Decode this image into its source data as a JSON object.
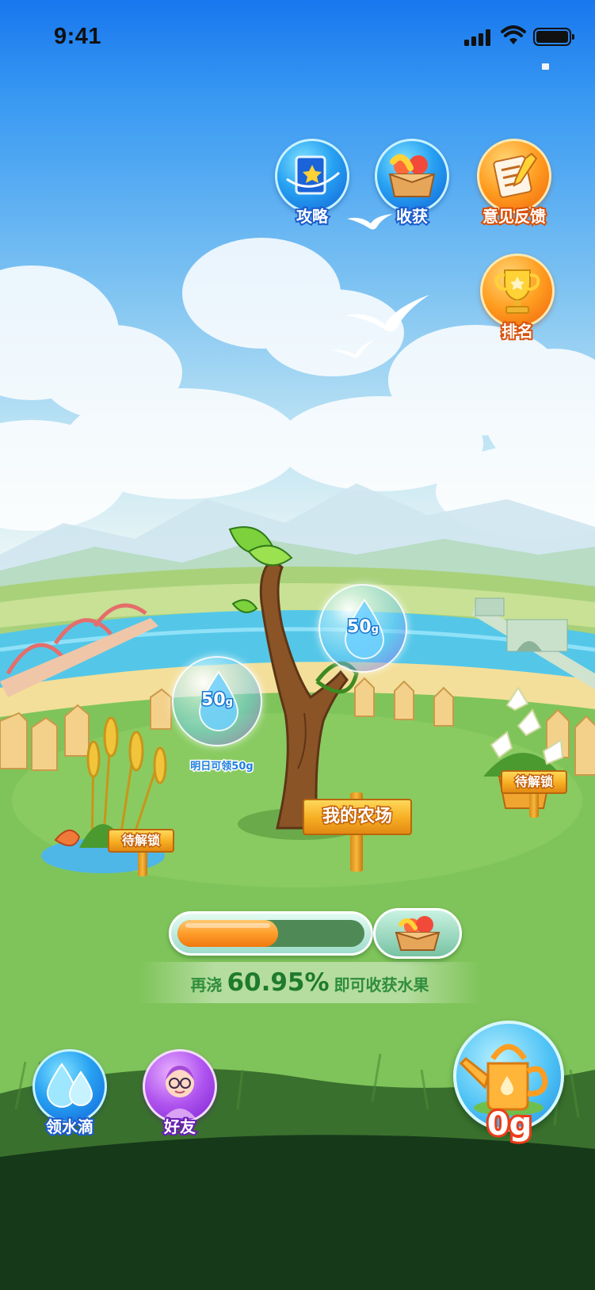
{
  "status_bar": {
    "time": "9:41"
  },
  "top_menu": {
    "guide_label": "攻略",
    "harvest_label": "收获",
    "feedback_label": "意见反馈",
    "ranking_label": "排名"
  },
  "farm": {
    "sign_label": "我的农场",
    "locked_left_label": "待解锁",
    "locked_right_label": "待解锁"
  },
  "bubbles": {
    "left": {
      "amount": "50",
      "unit": "g",
      "hint": "明日可领50g"
    },
    "right": {
      "amount": "50",
      "unit": "g"
    }
  },
  "progress": {
    "fill_fraction": 0.54,
    "prefix": "再浇",
    "percent": "60.95%",
    "suffix": "即可收获水果"
  },
  "bottom": {
    "get_water_label": "领水滴",
    "friends_label": "好友",
    "water_amount": "0g"
  },
  "colors": {
    "primary_blue": "#1c5ccc",
    "accent_orange": "#ff9d20",
    "progress_text_green": "#2f8d3b",
    "water_amount_stroke": "#ee3c18"
  },
  "icons": [
    "signal-icon",
    "wifi-icon",
    "battery-icon",
    "guide-book-icon",
    "fruit-box-icon",
    "feedback-notes-icon",
    "trophy-icon",
    "water-drop-icon",
    "friend-avatar-icon",
    "watering-can-icon"
  ]
}
